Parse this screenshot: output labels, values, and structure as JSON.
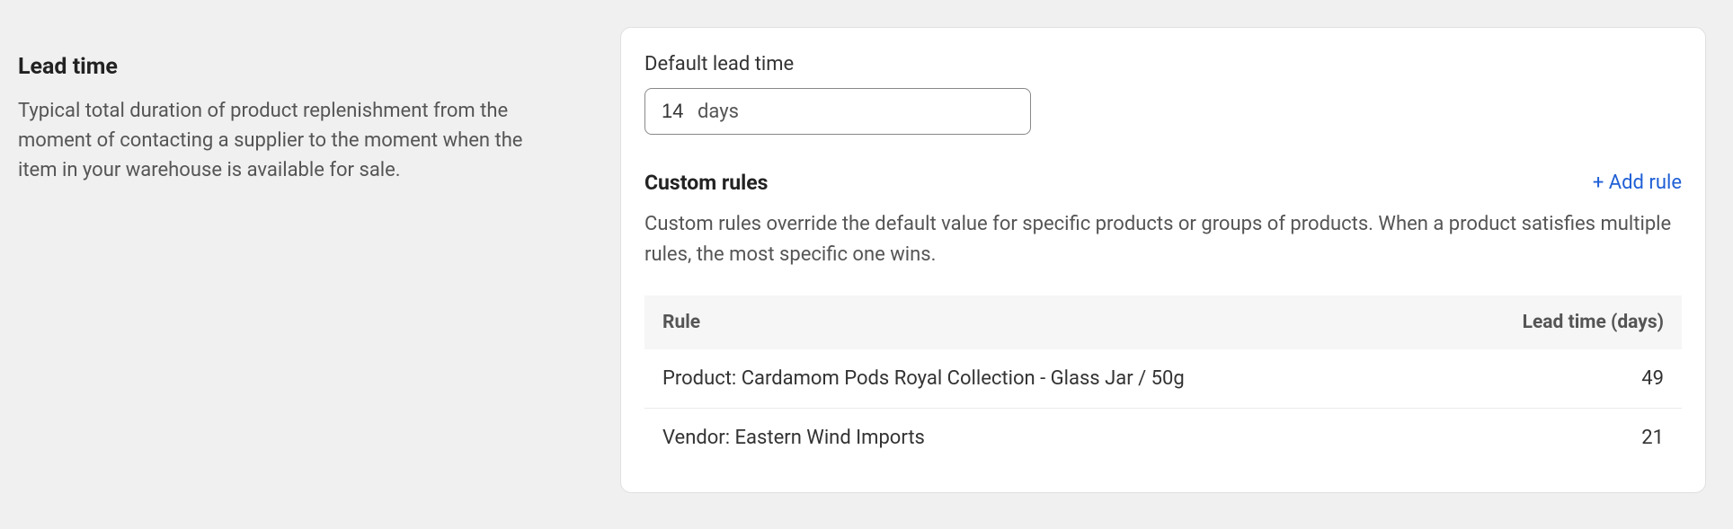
{
  "left": {
    "title": "Lead time",
    "description": "Typical total duration of product replenishment from the moment of contacting a supplier to the moment when the item in your warehouse is available for sale."
  },
  "right": {
    "default_lead_time_label": "Default lead time",
    "default_lead_time_value": "14",
    "default_lead_time_suffix": "days",
    "custom_rules": {
      "title": "Custom rules",
      "add_rule_label": "+ Add rule",
      "description": "Custom rules override the default value for specific products or groups of products. When a product satisfies multiple rules, the most specific one wins.",
      "table": {
        "headers": {
          "rule": "Rule",
          "lead_time": "Lead time (days)"
        },
        "rows": [
          {
            "rule": "Product: Cardamom Pods Royal Collection - Glass Jar / 50g",
            "lead_time": "49"
          },
          {
            "rule": "Vendor: Eastern Wind Imports",
            "lead_time": "21"
          }
        ]
      }
    }
  }
}
